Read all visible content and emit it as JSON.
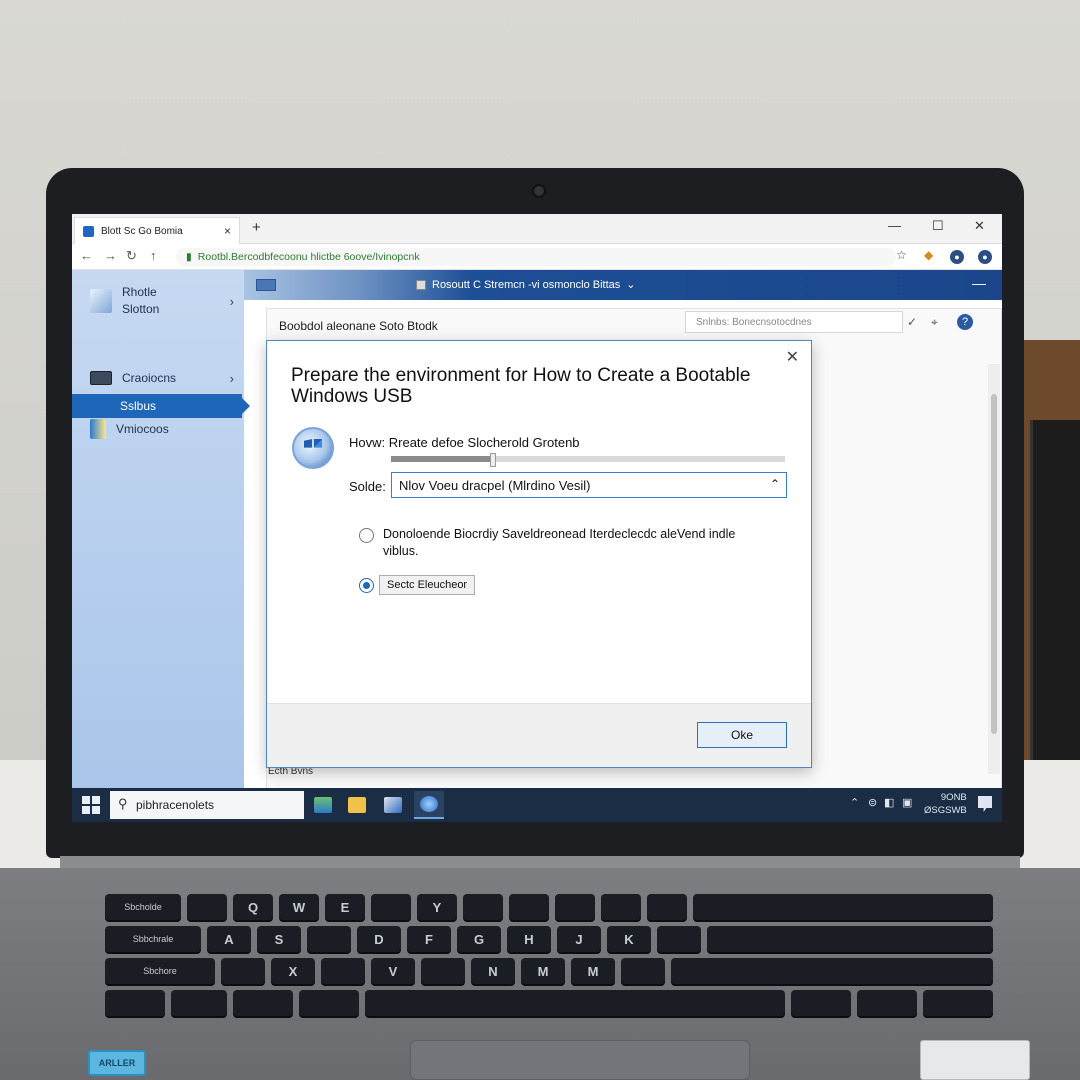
{
  "browser": {
    "tab_title": "Blott Sc Go Bomia",
    "tab_close": "×",
    "new_tab": "+",
    "minimize": "—",
    "maximize": "☐",
    "close": "✕",
    "url": "Rootbl.Bercodbfecoonu hlictbe 6oove/Ivinopcnk"
  },
  "app": {
    "title": "Rosoutt C Stremcn -vi osmonclo Bittas",
    "sidebar": {
      "items": [
        {
          "label_line1": "Rhotle",
          "label_line2": "Slotton"
        },
        {
          "label": "Craoiocns"
        },
        {
          "label": "Vmiocoos"
        }
      ],
      "selected_label": "Sslbus"
    },
    "panel_title": "Boobdol aleonane Soto Btodk",
    "search_placeholder": "Snlnbs: Bonecnsotocdnes",
    "status_text": "Ecth Bvns"
  },
  "dialog": {
    "close": "✕",
    "title": "Prepare the environment for How to Create a Bootable Windows USB",
    "how_label": "Hovw:",
    "how_value": "Rreate defoe Slocherold Grotenb",
    "slider_level": 0.26,
    "select_label": "Solde:",
    "select_value": "Nlov Voeu dracpel (Mlrdino Vesil)",
    "option1_text": "Donoloende Biocrdiy Saveldreonead Iterdeclecdc aleVend indle viblus.",
    "option2_button": "Sectc Eleucheor",
    "selected_option": 2,
    "ok_label": "Oke"
  },
  "taskbar": {
    "search_text": "pibhracenolets",
    "clock_line1": "9ONB",
    "clock_line2": "ØSGSWB"
  },
  "keyboard": {
    "row1": [
      "Sbcholde",
      "",
      "Q",
      "W",
      "E",
      "",
      "Y",
      "",
      "",
      "",
      "",
      "",
      ""
    ],
    "row2": [
      "Sbbchrale",
      "A",
      "S",
      "",
      "D",
      "F",
      "G",
      "H",
      "J",
      "K",
      "",
      ""
    ],
    "row3": [
      "Sbchore",
      "",
      "X",
      "",
      "V",
      "",
      "N",
      "M",
      "M",
      "",
      ""
    ],
    "sticker": "ARLLER"
  },
  "colors": {
    "accent": "#1d66b8",
    "appbar": "#1b468a",
    "taskbar": "#1a2d45",
    "sidebar": "#bcd2ef"
  }
}
